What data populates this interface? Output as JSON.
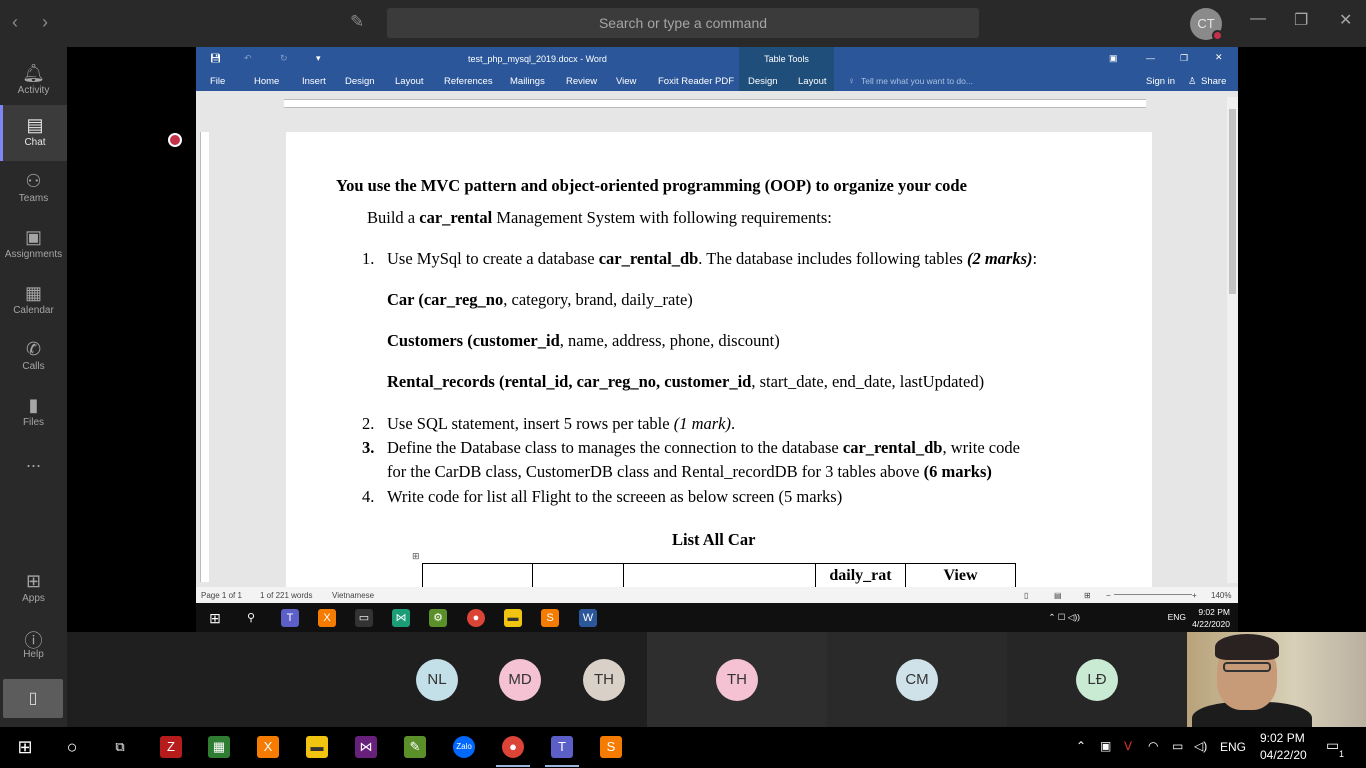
{
  "teams": {
    "search_placeholder": "Search or type a command",
    "user_initials": "CT",
    "rail": [
      {
        "label": "Activity",
        "icon": "bell-icon"
      },
      {
        "label": "Chat",
        "icon": "chat-icon"
      },
      {
        "label": "Teams",
        "icon": "teams-icon"
      },
      {
        "label": "Assignments",
        "icon": "assignments-icon"
      },
      {
        "label": "Calendar",
        "icon": "calendar-icon"
      },
      {
        "label": "Calls",
        "icon": "phone-icon"
      },
      {
        "label": "Files",
        "icon": "file-icon"
      },
      {
        "label": "...",
        "icon": "more-icon"
      },
      {
        "label": "Apps",
        "icon": "apps-icon"
      },
      {
        "label": "Help",
        "icon": "help-icon"
      }
    ],
    "participants": [
      "NL",
      "MD",
      "TH",
      "TH",
      "CM",
      "LĐ"
    ],
    "participant_colors": [
      "#c3e0e8",
      "#f4c2d3",
      "#d9d1c7",
      "#f4c2d3",
      "#cfe2ea",
      "#c9ead3"
    ]
  },
  "word": {
    "title": "test_php_mysql_2019.docx - Word",
    "table_tools": "Table Tools",
    "sign_in": "Sign in",
    "share": "Share",
    "tell_me": "Tell me what you want to do...",
    "tabs": [
      "File",
      "Home",
      "Insert",
      "Design",
      "Layout",
      "References",
      "Mailings",
      "Review",
      "View",
      "Foxit Reader PDF",
      "Design",
      "Layout"
    ],
    "status": {
      "page": "Page 1 of 1",
      "words": "1 of 221 words",
      "language": "Vietnamese",
      "zoom": "140%"
    }
  },
  "document": {
    "heading": "You use the MVC pattern and object-oriented programming (OOP) to organize your code",
    "intro_pre": "Build a ",
    "intro_bold": "car_rental",
    "intro_post": " Management System with following requirements:",
    "item1": {
      "num": "1.",
      "pre": "Use MySql to create a database ",
      "bold": "car_rental_db",
      "mid": ". The database includes following tables ",
      "marks": "(2 marks)",
      "post": ":"
    },
    "car": {
      "name": "Car (",
      "key": "car_reg_no",
      "rest": ", category, brand, daily_rate)"
    },
    "customers": {
      "name": "Customers (",
      "key": "customer_id",
      "rest": ", name, address, phone, discount)"
    },
    "rental": {
      "name": "Rental_records (",
      "key": "rental_id, car_reg_no, customer_id",
      "rest": ", start_date, end_date, lastUpdated)"
    },
    "item2": {
      "num": "2.",
      "text": "Use SQL statement, insert 5 rows per table ",
      "marks": "(1 mark)",
      "post": "."
    },
    "item3": {
      "num": "3.",
      "line1_pre": "Define the Database class to manages the connection to the database ",
      "line1_bold": "car_rental_db",
      "line1_post": ", write code",
      "line2": "for the CarDB class, CustomerDB class and Rental_recordDB for 3 tables above  ",
      "marks": "(6 marks)"
    },
    "item4": {
      "num": "4.",
      "text": "Write code for list all Flight to the screeen as below screen (5 marks)"
    },
    "table_title": "List All Car",
    "table_headers": [
      "",
      "",
      "",
      "daily_rat",
      "View"
    ]
  },
  "inner_tray": {
    "lang": "ENG",
    "time": "9:02 PM",
    "date": "4/22/2020"
  },
  "tray": {
    "lang": "ENG",
    "time": "9:02 PM",
    "date": "04/22/20",
    "notifications": "1"
  }
}
